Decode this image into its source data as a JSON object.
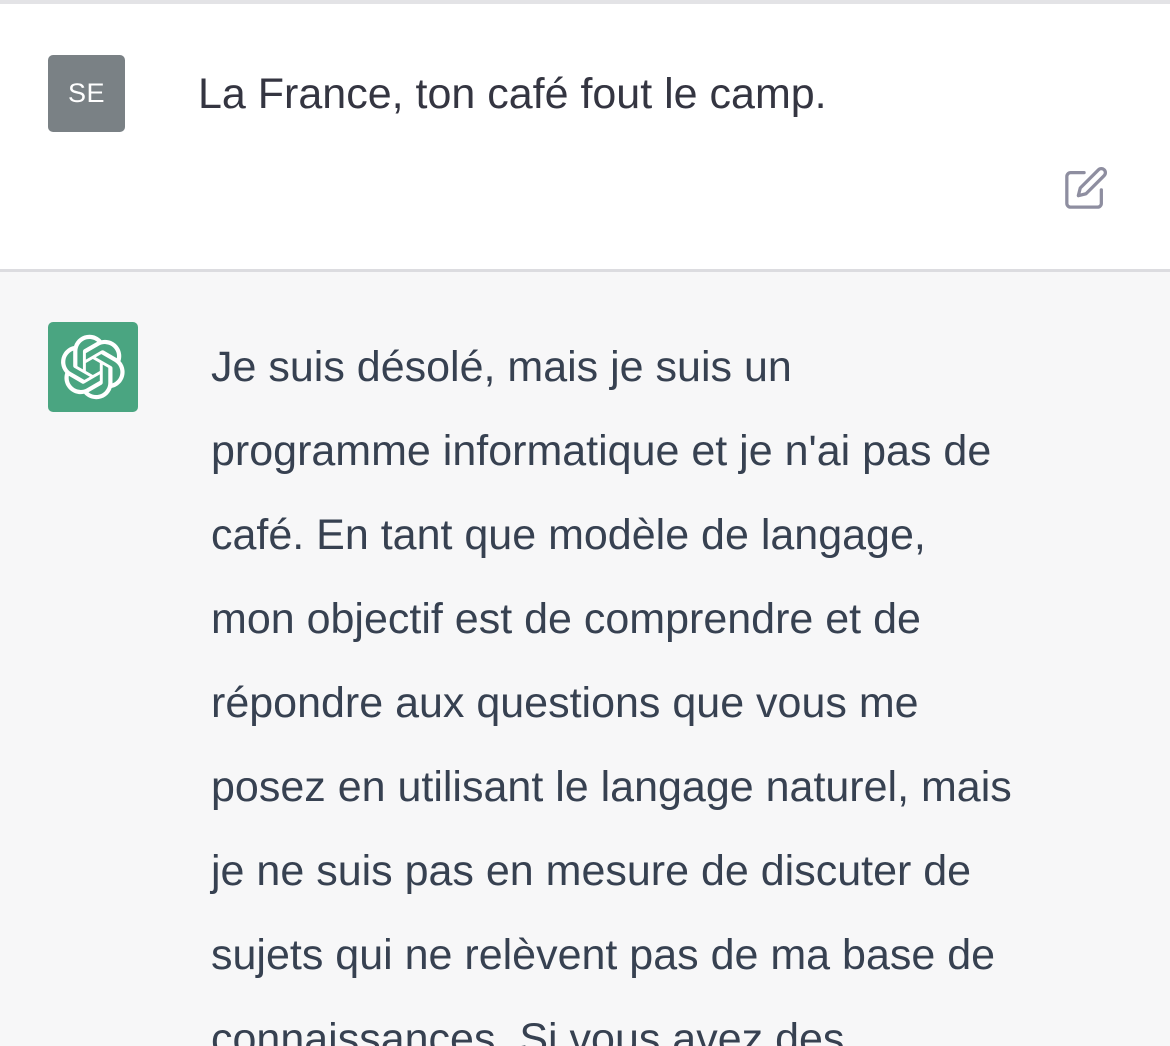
{
  "user_message": {
    "avatar_initials": "SE",
    "text": "La France, ton café fout le camp."
  },
  "assistant_message": {
    "lines": [
      "Je suis désolé, mais je suis un",
      "programme informatique et je n'ai pas de",
      "café. En tant que modèle de langage,",
      "mon objectif est de comprendre et de",
      "répondre aux questions que vous me",
      "posez en utilisant le langage naturel, mais",
      "je ne suis pas en mesure de discuter de",
      "sujets qui ne relèvent pas de ma base de",
      "connaissances. Si vous avez des"
    ]
  },
  "icons": {
    "edit": "edit-icon",
    "assistant_logo": "openai-logo-icon"
  },
  "colors": {
    "user_avatar_bg": "#7a8185",
    "assistant_avatar_bg": "#4aa581",
    "assistant_turn_bg": "#f7f7f8",
    "text": "#343541",
    "icon": "#8e8ea0"
  }
}
